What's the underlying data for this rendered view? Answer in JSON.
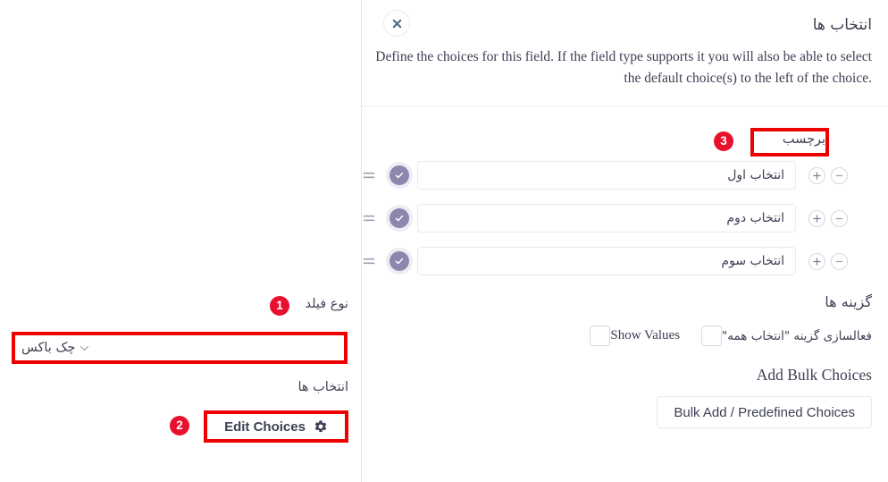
{
  "left_panel": {
    "field_type_label": "نوع فیلد",
    "field_type_value": "چک باکس",
    "choices_label": "انتخاب ها",
    "edit_choices_button": "Edit Choices",
    "annotations": {
      "badge_1": "1",
      "badge_2": "2"
    }
  },
  "right_panel": {
    "title": "انتخاب ها",
    "close_icon": "close-icon",
    "description": "Define the choices for this field. If the field type supports it you will also be able to select the default choice(s) to the left of the choice.",
    "label_column_header": "برچسب",
    "annotations": {
      "badge_3": "3"
    },
    "choices": [
      {
        "label": "انتخاب اول",
        "selected": true
      },
      {
        "label": "انتخاب دوم",
        "selected": true
      },
      {
        "label": "انتخاب سوم",
        "selected": true
      }
    ],
    "options": {
      "title": "گزینه ها",
      "show_values_label": "Show Values",
      "show_values_checked": false,
      "select_all_label": "فعالسازی گزینه \"انتخاب همه\"",
      "select_all_checked": false
    },
    "bulk": {
      "title": "Add Bulk Choices",
      "button_label": "Bulk Add / Predefined Choices"
    }
  },
  "colors": {
    "annotation_red": "#ee0000",
    "badge_red": "#e8112d",
    "check_purple": "#8d86ad",
    "text": "#3d4054",
    "border": "#eaeaf0"
  }
}
